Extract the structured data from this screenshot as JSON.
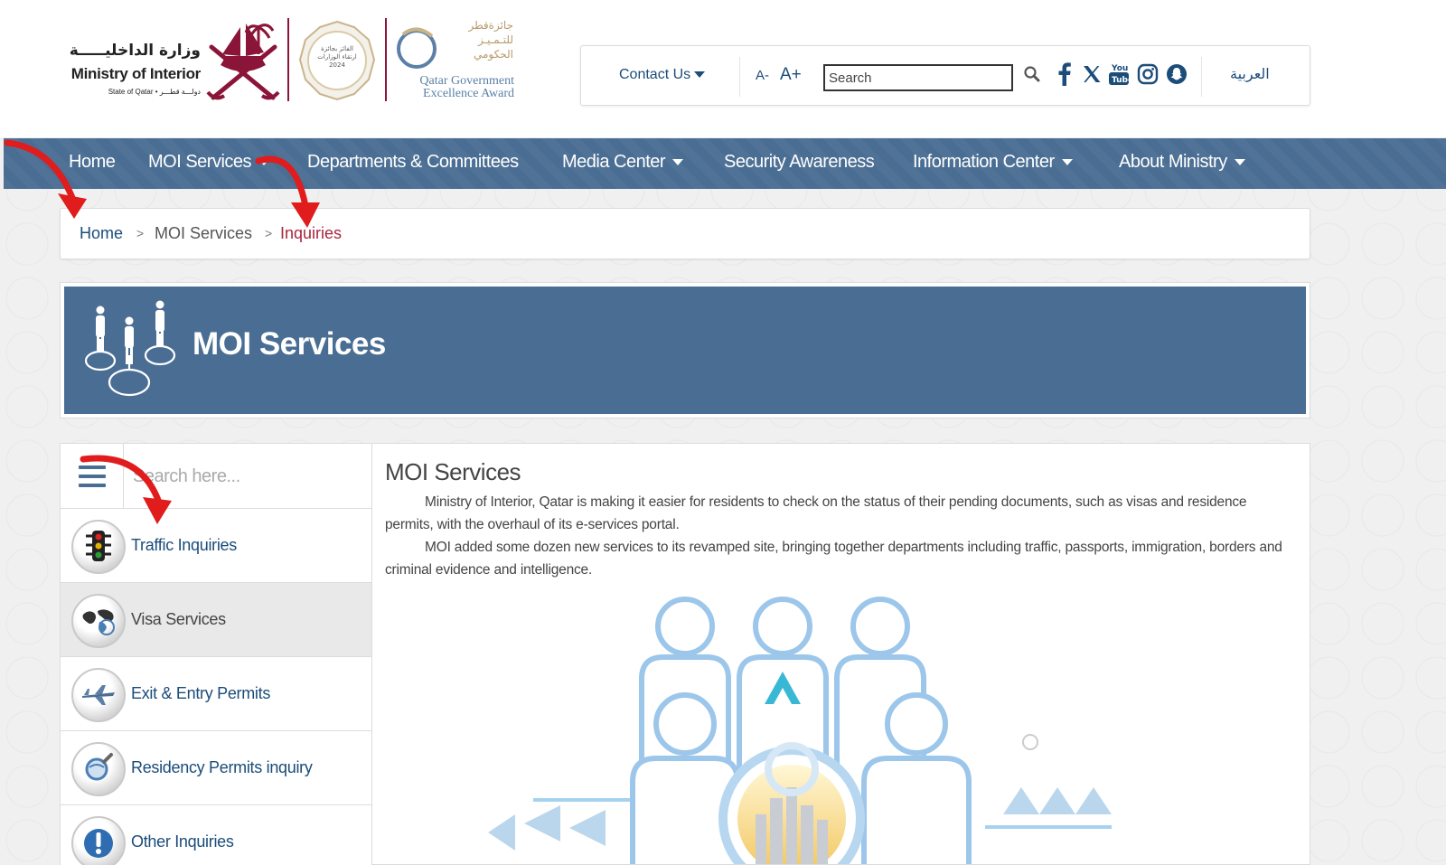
{
  "header": {
    "moi_logo": {
      "arabic": "وزارة الداخليـــــة",
      "english": "Ministry of Interior",
      "subtitle": "State of Qatar • دولـــة قطـــر"
    },
    "award_badge_text": "الفائز بجائزة ارتقاء الوزارات 2024",
    "award_logo": {
      "arabic_line1": "جائزةقطر",
      "arabic_line2": "للتـمـيـز",
      "arabic_line3": "الحكومي",
      "english_line1": "Qatar Government",
      "english_line2": "Excellence Award"
    }
  },
  "toolbar": {
    "contact_label": "Contact Us",
    "font_decrease": "A-",
    "font_increase": "A+",
    "search_placeholder": "Search",
    "language_label": "العربية"
  },
  "nav": {
    "items": [
      {
        "label": "Home"
      },
      {
        "label": "MOI Services"
      },
      {
        "label": "Departments & Committees"
      },
      {
        "label": "Media Center"
      },
      {
        "label": "Security Awareness"
      },
      {
        "label": "Information Center"
      },
      {
        "label": "About Ministry"
      }
    ]
  },
  "breadcrumb": {
    "home": "Home",
    "separator": ">",
    "services": "MOI Services",
    "current": "Inquiries"
  },
  "banner": {
    "title": "MOI Services"
  },
  "sidebar": {
    "search_placeholder": "Search here...",
    "items": [
      {
        "label": "Traffic Inquiries",
        "icon": "traffic-light-icon"
      },
      {
        "label": "Visa Services",
        "icon": "world-map-icon"
      },
      {
        "label": "Exit & Entry Permits",
        "icon": "airplane-icon"
      },
      {
        "label": "Residency Permits inquiry",
        "icon": "magnifier-globe-icon"
      },
      {
        "label": "Other Inquiries",
        "icon": "exclamation-icon"
      }
    ]
  },
  "content": {
    "title": "MOI Services",
    "paragraph1": "Ministry of Interior, Qatar is making it easier for residents to check on the status of their pending documents, such as visas and residence permits, with the overhaul of its e-services portal.",
    "paragraph2": "MOI added some dozen new services to its revamped site, bringing together departments including traffic, passports, immigration, borders and criminal evidence and intelligence."
  },
  "colors": {
    "nav_bg": "#4a6e93",
    "link_blue": "#1b4c7a",
    "maroon": "#8a1538",
    "current_crumb": "#a8263e",
    "arrow_red": "#e01c1c"
  }
}
